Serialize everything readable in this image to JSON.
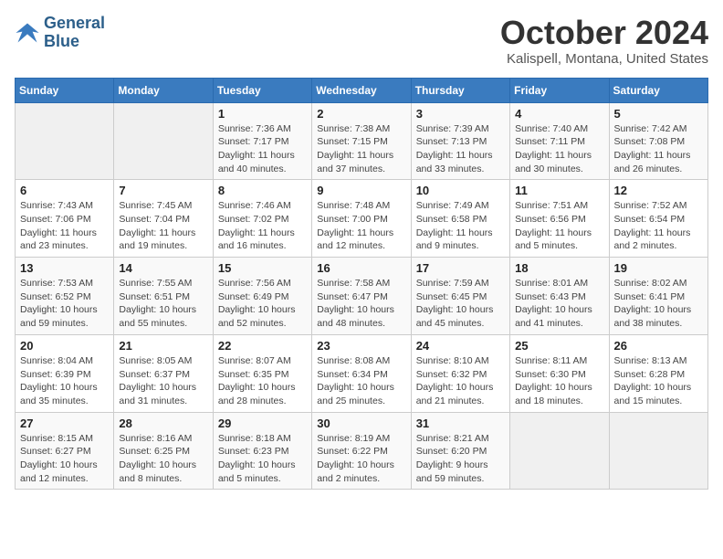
{
  "header": {
    "logo_line1": "General",
    "logo_line2": "Blue",
    "month": "October 2024",
    "location": "Kalispell, Montana, United States"
  },
  "weekdays": [
    "Sunday",
    "Monday",
    "Tuesday",
    "Wednesday",
    "Thursday",
    "Friday",
    "Saturday"
  ],
  "weeks": [
    [
      {
        "day": "",
        "info": ""
      },
      {
        "day": "",
        "info": ""
      },
      {
        "day": "1",
        "info": "Sunrise: 7:36 AM\nSunset: 7:17 PM\nDaylight: 11 hours and 40 minutes."
      },
      {
        "day": "2",
        "info": "Sunrise: 7:38 AM\nSunset: 7:15 PM\nDaylight: 11 hours and 37 minutes."
      },
      {
        "day": "3",
        "info": "Sunrise: 7:39 AM\nSunset: 7:13 PM\nDaylight: 11 hours and 33 minutes."
      },
      {
        "day": "4",
        "info": "Sunrise: 7:40 AM\nSunset: 7:11 PM\nDaylight: 11 hours and 30 minutes."
      },
      {
        "day": "5",
        "info": "Sunrise: 7:42 AM\nSunset: 7:08 PM\nDaylight: 11 hours and 26 minutes."
      }
    ],
    [
      {
        "day": "6",
        "info": "Sunrise: 7:43 AM\nSunset: 7:06 PM\nDaylight: 11 hours and 23 minutes."
      },
      {
        "day": "7",
        "info": "Sunrise: 7:45 AM\nSunset: 7:04 PM\nDaylight: 11 hours and 19 minutes."
      },
      {
        "day": "8",
        "info": "Sunrise: 7:46 AM\nSunset: 7:02 PM\nDaylight: 11 hours and 16 minutes."
      },
      {
        "day": "9",
        "info": "Sunrise: 7:48 AM\nSunset: 7:00 PM\nDaylight: 11 hours and 12 minutes."
      },
      {
        "day": "10",
        "info": "Sunrise: 7:49 AM\nSunset: 6:58 PM\nDaylight: 11 hours and 9 minutes."
      },
      {
        "day": "11",
        "info": "Sunrise: 7:51 AM\nSunset: 6:56 PM\nDaylight: 11 hours and 5 minutes."
      },
      {
        "day": "12",
        "info": "Sunrise: 7:52 AM\nSunset: 6:54 PM\nDaylight: 11 hours and 2 minutes."
      }
    ],
    [
      {
        "day": "13",
        "info": "Sunrise: 7:53 AM\nSunset: 6:52 PM\nDaylight: 10 hours and 59 minutes."
      },
      {
        "day": "14",
        "info": "Sunrise: 7:55 AM\nSunset: 6:51 PM\nDaylight: 10 hours and 55 minutes."
      },
      {
        "day": "15",
        "info": "Sunrise: 7:56 AM\nSunset: 6:49 PM\nDaylight: 10 hours and 52 minutes."
      },
      {
        "day": "16",
        "info": "Sunrise: 7:58 AM\nSunset: 6:47 PM\nDaylight: 10 hours and 48 minutes."
      },
      {
        "day": "17",
        "info": "Sunrise: 7:59 AM\nSunset: 6:45 PM\nDaylight: 10 hours and 45 minutes."
      },
      {
        "day": "18",
        "info": "Sunrise: 8:01 AM\nSunset: 6:43 PM\nDaylight: 10 hours and 41 minutes."
      },
      {
        "day": "19",
        "info": "Sunrise: 8:02 AM\nSunset: 6:41 PM\nDaylight: 10 hours and 38 minutes."
      }
    ],
    [
      {
        "day": "20",
        "info": "Sunrise: 8:04 AM\nSunset: 6:39 PM\nDaylight: 10 hours and 35 minutes."
      },
      {
        "day": "21",
        "info": "Sunrise: 8:05 AM\nSunset: 6:37 PM\nDaylight: 10 hours and 31 minutes."
      },
      {
        "day": "22",
        "info": "Sunrise: 8:07 AM\nSunset: 6:35 PM\nDaylight: 10 hours and 28 minutes."
      },
      {
        "day": "23",
        "info": "Sunrise: 8:08 AM\nSunset: 6:34 PM\nDaylight: 10 hours and 25 minutes."
      },
      {
        "day": "24",
        "info": "Sunrise: 8:10 AM\nSunset: 6:32 PM\nDaylight: 10 hours and 21 minutes."
      },
      {
        "day": "25",
        "info": "Sunrise: 8:11 AM\nSunset: 6:30 PM\nDaylight: 10 hours and 18 minutes."
      },
      {
        "day": "26",
        "info": "Sunrise: 8:13 AM\nSunset: 6:28 PM\nDaylight: 10 hours and 15 minutes."
      }
    ],
    [
      {
        "day": "27",
        "info": "Sunrise: 8:15 AM\nSunset: 6:27 PM\nDaylight: 10 hours and 12 minutes."
      },
      {
        "day": "28",
        "info": "Sunrise: 8:16 AM\nSunset: 6:25 PM\nDaylight: 10 hours and 8 minutes."
      },
      {
        "day": "29",
        "info": "Sunrise: 8:18 AM\nSunset: 6:23 PM\nDaylight: 10 hours and 5 minutes."
      },
      {
        "day": "30",
        "info": "Sunrise: 8:19 AM\nSunset: 6:22 PM\nDaylight: 10 hours and 2 minutes."
      },
      {
        "day": "31",
        "info": "Sunrise: 8:21 AM\nSunset: 6:20 PM\nDaylight: 9 hours and 59 minutes."
      },
      {
        "day": "",
        "info": ""
      },
      {
        "day": "",
        "info": ""
      }
    ]
  ]
}
